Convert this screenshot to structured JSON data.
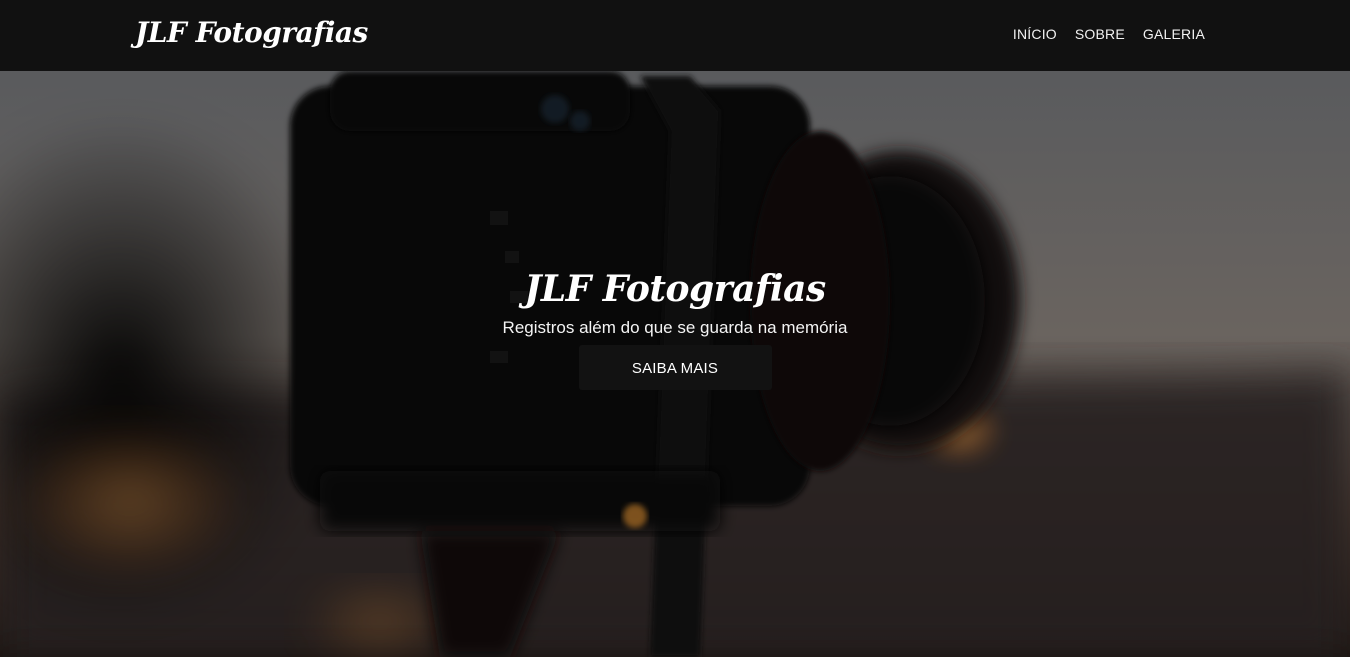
{
  "navbar": {
    "brand": "JLF Fotografias",
    "links": [
      {
        "label": "INÍCIO"
      },
      {
        "label": "SOBRE"
      },
      {
        "label": "GALERIA"
      }
    ]
  },
  "hero": {
    "title": "JLF Fotografias",
    "subtitle": "Registros além do que se guarda na memória",
    "button_label": "SAIBA MAIS",
    "background_image": "blurred-camera-photo"
  },
  "colors": {
    "navbar_bg": "#111111",
    "button_bg": "#121212",
    "text": "#ffffff"
  }
}
